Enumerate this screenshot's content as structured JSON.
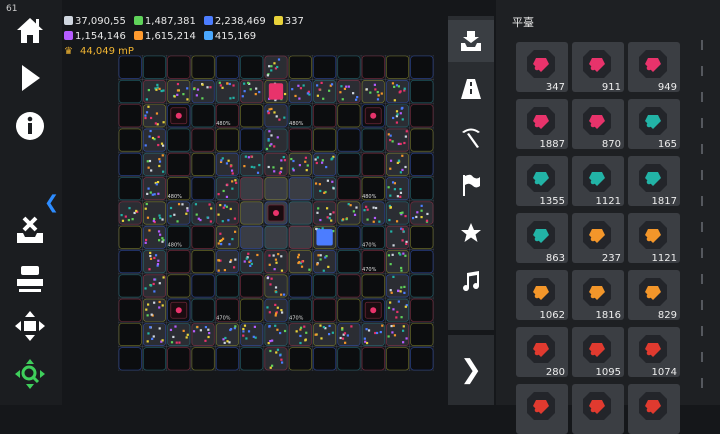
{
  "fps": "61",
  "resources": {
    "row1": [
      {
        "icon": "gem-bag-icon",
        "color": "#cfd6df",
        "value": "37,090,55"
      },
      {
        "icon": "green-gem-icon",
        "color": "#5fd35a",
        "value": "1,487,381"
      },
      {
        "icon": "blue-gem-icon",
        "color": "#4c7dff",
        "value": "2,238,469"
      },
      {
        "icon": "yellow-gem-icon",
        "color": "#e8d23a",
        "value": "337"
      }
    ],
    "row2": [
      {
        "icon": "purple-gem-icon",
        "color": "#b55cff",
        "value": "1,154,146"
      },
      {
        "icon": "orange-gem-icon",
        "color": "#ff9a2e",
        "value": "1,615,214"
      },
      {
        "icon": "blue-gem-icon",
        "color": "#4aa8ff",
        "value": "415,169"
      }
    ],
    "mp": "44,049 mP"
  },
  "board_labels": [
    "480%",
    "480%",
    "480%",
    "480%",
    "480%",
    "470%",
    "470%",
    "470%",
    "470%"
  ],
  "tabs": [
    "inbox-icon",
    "road-icon",
    "pickaxe-icon",
    "flag-icon",
    "star-icon",
    "music-icon"
  ],
  "panel": {
    "title": "平臺",
    "cards": [
      {
        "color": "#e8336b",
        "count": "347"
      },
      {
        "color": "#e8336b",
        "count": "911"
      },
      {
        "color": "#e8336b",
        "count": "949"
      },
      {
        "color": "#e8336b",
        "count": "1887"
      },
      {
        "color": "#e8336b",
        "count": "870"
      },
      {
        "color": "#22b3a6",
        "count": "165"
      },
      {
        "color": "#22b3a6",
        "count": "1355"
      },
      {
        "color": "#22b3a6",
        "count": "1121"
      },
      {
        "color": "#22b3a6",
        "count": "1817"
      },
      {
        "color": "#22b3a6",
        "count": "863"
      },
      {
        "color": "#f3962a",
        "count": "237"
      },
      {
        "color": "#f3962a",
        "count": "1121"
      },
      {
        "color": "#f3962a",
        "count": "1062"
      },
      {
        "color": "#f3962a",
        "count": "1816"
      },
      {
        "color": "#f3962a",
        "count": "829"
      },
      {
        "color": "#e03a2f",
        "count": "280"
      },
      {
        "color": "#e03a2f",
        "count": "1095"
      },
      {
        "color": "#e03a2f",
        "count": "1074"
      },
      {
        "color": "#e03a2f",
        "count": ""
      },
      {
        "color": "#e03a2f",
        "count": ""
      },
      {
        "color": "#e03a2f",
        "count": ""
      }
    ]
  }
}
